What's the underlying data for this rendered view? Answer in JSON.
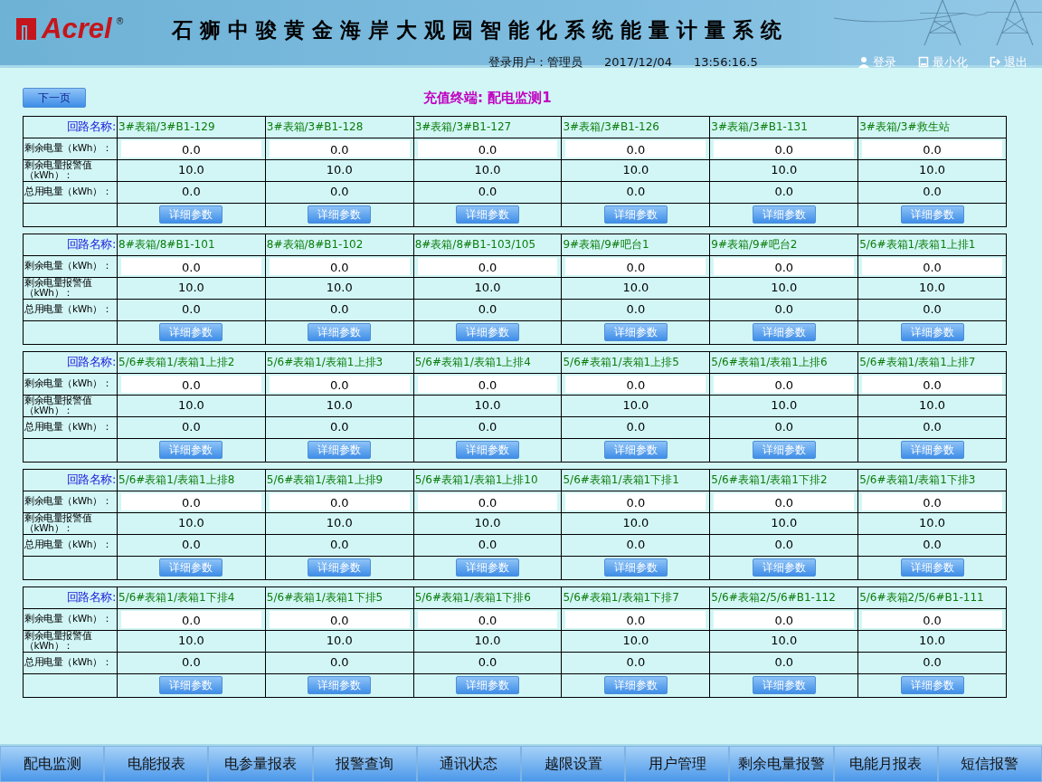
{
  "header": {
    "logo": "Acrel",
    "registered": "®",
    "title": "石狮中骏黄金海岸大观园智能化系统能量计量系统",
    "user_label": "登录用户：管理员",
    "date": "2017/12/04",
    "time": "13:56:16.5",
    "actions": [
      {
        "kind": "login",
        "label": "登录"
      },
      {
        "kind": "minimize",
        "label": "最小化"
      },
      {
        "kind": "exit",
        "label": "退出"
      }
    ]
  },
  "next_page": "下一页",
  "page_title": "充值终端: 配电监测1",
  "groups": [
    {
      "labels": {
        "name": "回路名称:",
        "remaining": "剩余电量（kWh）：",
        "alarm": "剩余电量报警值（kWh）：",
        "total": "总用电量（kWh）："
      },
      "circuits": [
        {
          "name": "3#表箱/3#B1-129",
          "remaining": "0.0",
          "alarm": "10.0",
          "total": "0.0",
          "button": "详细参数"
        },
        {
          "name": "3#表箱/3#B1-128",
          "remaining": "0.0",
          "alarm": "10.0",
          "total": "0.0",
          "button": "详细参数"
        },
        {
          "name": "3#表箱/3#B1-127",
          "remaining": "0.0",
          "alarm": "10.0",
          "total": "0.0",
          "button": "详细参数"
        },
        {
          "name": "3#表箱/3#B1-126",
          "remaining": "0.0",
          "alarm": "10.0",
          "total": "0.0",
          "button": "详细参数"
        },
        {
          "name": "3#表箱/3#B1-131",
          "remaining": "0.0",
          "alarm": "10.0",
          "total": "0.0",
          "button": "详细参数"
        },
        {
          "name": "3#表箱/3#救生站",
          "remaining": "0.0",
          "alarm": "10.0",
          "total": "0.0",
          "button": "详细参数"
        }
      ]
    },
    {
      "labels": {
        "name": "回路名称:",
        "remaining": "剩余电量（kWh）：",
        "alarm": "剩余电量报警值（kWh）：",
        "total": "总用电量（kWh）："
      },
      "circuits": [
        {
          "name": "8#表箱/8#B1-101",
          "remaining": "0.0",
          "alarm": "10.0",
          "total": "0.0",
          "button": "详细参数"
        },
        {
          "name": "8#表箱/8#B1-102",
          "remaining": "0.0",
          "alarm": "10.0",
          "total": "0.0",
          "button": "详细参数"
        },
        {
          "name": "8#表箱/8#B1-103/105",
          "remaining": "0.0",
          "alarm": "10.0",
          "total": "0.0",
          "button": "详细参数"
        },
        {
          "name": "9#表箱/9#吧台1",
          "remaining": "0.0",
          "alarm": "10.0",
          "total": "0.0",
          "button": "详细参数"
        },
        {
          "name": "9#表箱/9#吧台2",
          "remaining": "0.0",
          "alarm": "10.0",
          "total": "0.0",
          "button": "详细参数"
        },
        {
          "name": "5/6#表箱1/表箱1上排1",
          "remaining": "0.0",
          "alarm": "10.0",
          "total": "0.0",
          "button": "详细参数"
        }
      ]
    },
    {
      "labels": {
        "name": "回路名称:",
        "remaining": "剩余电量（kWh）：",
        "alarm": "剩余电量报警值（kWh）：",
        "total": "总用电量（kWh）："
      },
      "circuits": [
        {
          "name": "5/6#表箱1/表箱1上排2",
          "remaining": "0.0",
          "alarm": "10.0",
          "total": "0.0",
          "button": "详细参数"
        },
        {
          "name": "5/6#表箱1/表箱1上排3",
          "remaining": "0.0",
          "alarm": "10.0",
          "total": "0.0",
          "button": "详细参数"
        },
        {
          "name": "5/6#表箱1/表箱1上排4",
          "remaining": "0.0",
          "alarm": "10.0",
          "total": "0.0",
          "button": "详细参数"
        },
        {
          "name": "5/6#表箱1/表箱1上排5",
          "remaining": "0.0",
          "alarm": "10.0",
          "total": "0.0",
          "button": "详细参数"
        },
        {
          "name": "5/6#表箱1/表箱1上排6",
          "remaining": "0.0",
          "alarm": "10.0",
          "total": "0.0",
          "button": "详细参数"
        },
        {
          "name": "5/6#表箱1/表箱1上排7",
          "remaining": "0.0",
          "alarm": "10.0",
          "total": "0.0",
          "button": "详细参数"
        }
      ]
    },
    {
      "labels": {
        "name": "回路名称:",
        "remaining": "剩余电量（kWh）：",
        "alarm": "剩余电量报警值（kWh）：",
        "total": "总用电量（kWh）："
      },
      "circuits": [
        {
          "name": "5/6#表箱1/表箱1上排8",
          "remaining": "0.0",
          "alarm": "10.0",
          "total": "0.0",
          "button": "详细参数"
        },
        {
          "name": "5/6#表箱1/表箱1上排9",
          "remaining": "0.0",
          "alarm": "10.0",
          "total": "0.0",
          "button": "详细参数"
        },
        {
          "name": "5/6#表箱1/表箱1上排10",
          "remaining": "0.0",
          "alarm": "10.0",
          "total": "0.0",
          "button": "详细参数"
        },
        {
          "name": "5/6#表箱1/表箱1下排1",
          "remaining": "0.0",
          "alarm": "10.0",
          "total": "0.0",
          "button": "详细参数"
        },
        {
          "name": "5/6#表箱1/表箱1下排2",
          "remaining": "0.0",
          "alarm": "10.0",
          "total": "0.0",
          "button": "详细参数"
        },
        {
          "name": "5/6#表箱1/表箱1下排3",
          "remaining": "0.0",
          "alarm": "10.0",
          "total": "0.0",
          "button": "详细参数"
        }
      ]
    },
    {
      "labels": {
        "name": "回路名称:",
        "remaining": "剩余电量（kWh）：",
        "alarm": "剩余电量报警值（kWh）：",
        "total": "总用电量（kWh）："
      },
      "circuits": [
        {
          "name": "5/6#表箱1/表箱1下排4",
          "remaining": "0.0",
          "alarm": "10.0",
          "total": "0.0",
          "button": "详细参数"
        },
        {
          "name": "5/6#表箱1/表箱1下排5",
          "remaining": "0.0",
          "alarm": "10.0",
          "total": "0.0",
          "button": "详细参数"
        },
        {
          "name": "5/6#表箱1/表箱1下排6",
          "remaining": "0.0",
          "alarm": "10.0",
          "total": "0.0",
          "button": "详细参数"
        },
        {
          "name": "5/6#表箱1/表箱1下排7",
          "remaining": "0.0",
          "alarm": "10.0",
          "total": "0.0",
          "button": "详细参数"
        },
        {
          "name": "5/6#表箱2/5/6#B1-112",
          "remaining": "0.0",
          "alarm": "10.0",
          "total": "0.0",
          "button": "详细参数"
        },
        {
          "name": "5/6#表箱2/5/6#B1-111",
          "remaining": "0.0",
          "alarm": "10.0",
          "total": "0.0",
          "button": "详细参数"
        }
      ]
    }
  ],
  "bottom_nav": [
    "配电监测",
    "电能报表",
    "电参量报表",
    "报警查询",
    "通讯状态",
    "越限设置",
    "用户管理",
    "剩余电量报警",
    "电能月报表",
    "短信报警"
  ]
}
